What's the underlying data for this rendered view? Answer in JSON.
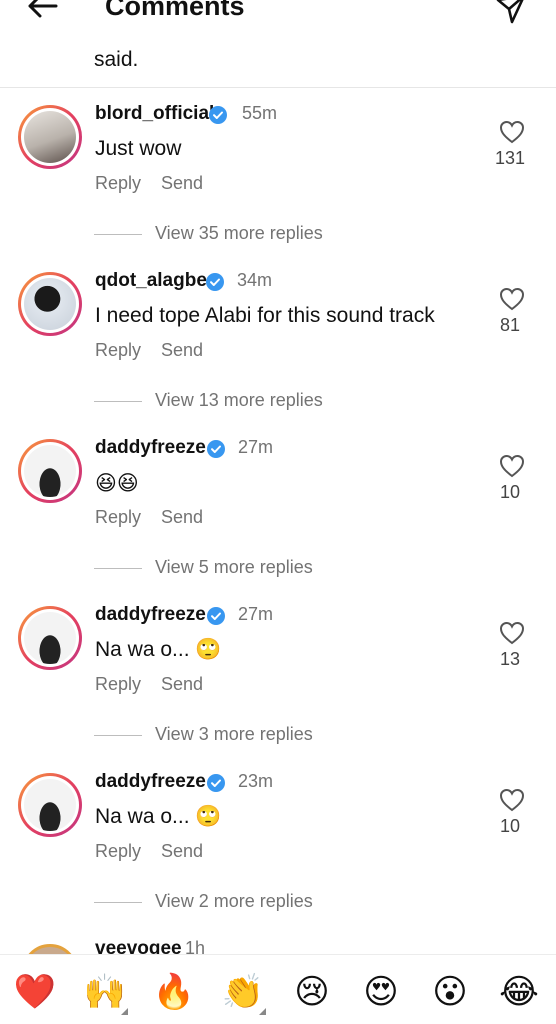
{
  "header": {
    "title": "Comments"
  },
  "previous_tail": "said.",
  "comments": [
    {
      "username": "blord_official",
      "time": "55m",
      "text": "Just wow",
      "reply": "Reply",
      "send": "Send",
      "likes": "131",
      "view_more": "View 35 more replies",
      "avatar_bg": "#d9d4cf"
    },
    {
      "username": "qdot_alagbe",
      "time": "34m",
      "text": "I need tope Alabi for this sound track",
      "reply": "Reply",
      "send": "Send",
      "likes": "81",
      "view_more": "View 13 more replies",
      "avatar_bg": "#cfd8e3"
    },
    {
      "username": "daddyfreeze",
      "time": "27m",
      "text": "😆😆",
      "reply": "Reply",
      "send": "Send",
      "likes": "10",
      "view_more": "View 5 more replies",
      "avatar_bg": "#f0f0f0"
    },
    {
      "username": "daddyfreeze",
      "time": "27m",
      "text": "Na wa o... 🙄",
      "reply": "Reply",
      "send": "Send",
      "likes": "13",
      "view_more": "View 3 more replies",
      "avatar_bg": "#f0f0f0"
    },
    {
      "username": "daddyfreeze",
      "time": "23m",
      "text": "Na wa o... 🙄",
      "reply": "Reply",
      "send": "Send",
      "likes": "10",
      "view_more": "View 2 more replies",
      "avatar_bg": "#f0f0f0"
    }
  ],
  "partial_comment": {
    "username": "veevogee",
    "time": "1h"
  },
  "emoji_bar": [
    "❤️",
    "🙌",
    "🔥",
    "👏",
    "😢",
    "😍",
    "😮",
    "😂"
  ],
  "colors": {
    "verified": "#3897f0",
    "secondary_text": "#737373",
    "heart": "#e0245e"
  }
}
